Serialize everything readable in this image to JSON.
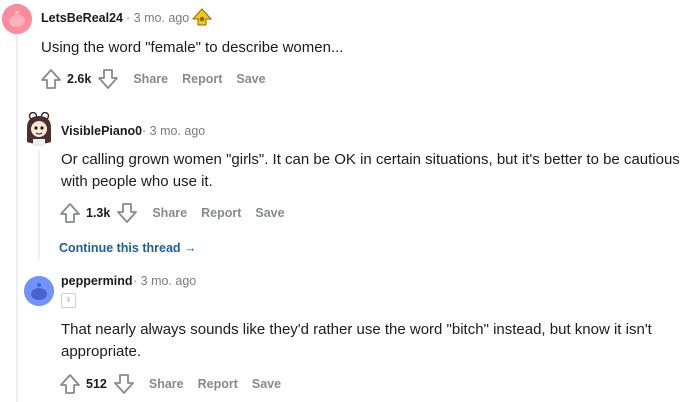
{
  "comments": [
    {
      "username": "LetsBeReal24",
      "age": "3 mo. ago",
      "award_icon": "golden-up-icon",
      "body": [
        "Using the word \"female\" to describe women..."
      ],
      "score": "2.6k",
      "share": "Share",
      "report": "Report",
      "save": "Save"
    },
    {
      "username": "VisiblePiano0",
      "age": "3 mo. ago",
      "body": [
        "Or calling grown women \"girls\". It can be OK in certain situations, but it's better to be cautious",
        "with people who use it."
      ],
      "score": "1.3k",
      "share": "Share",
      "report": "Report",
      "save": "Save"
    },
    {
      "username": "peppermind",
      "age": "3 mo. ago",
      "flair": "♀",
      "body": [
        "That nearly always sounds like they'd rather use the word \"bitch\" instead, but know it isn't",
        "appropriate."
      ],
      "score": "512",
      "share": "Share",
      "report": "Report",
      "save": "Save"
    }
  ],
  "continue_thread": "Continue this thread",
  "colors": {
    "link": "#1f5f99",
    "muted": "#878a8c",
    "thread_line": "#edeff1",
    "avatar1": "#ff8b9c",
    "avatar3": "#7193ff"
  }
}
